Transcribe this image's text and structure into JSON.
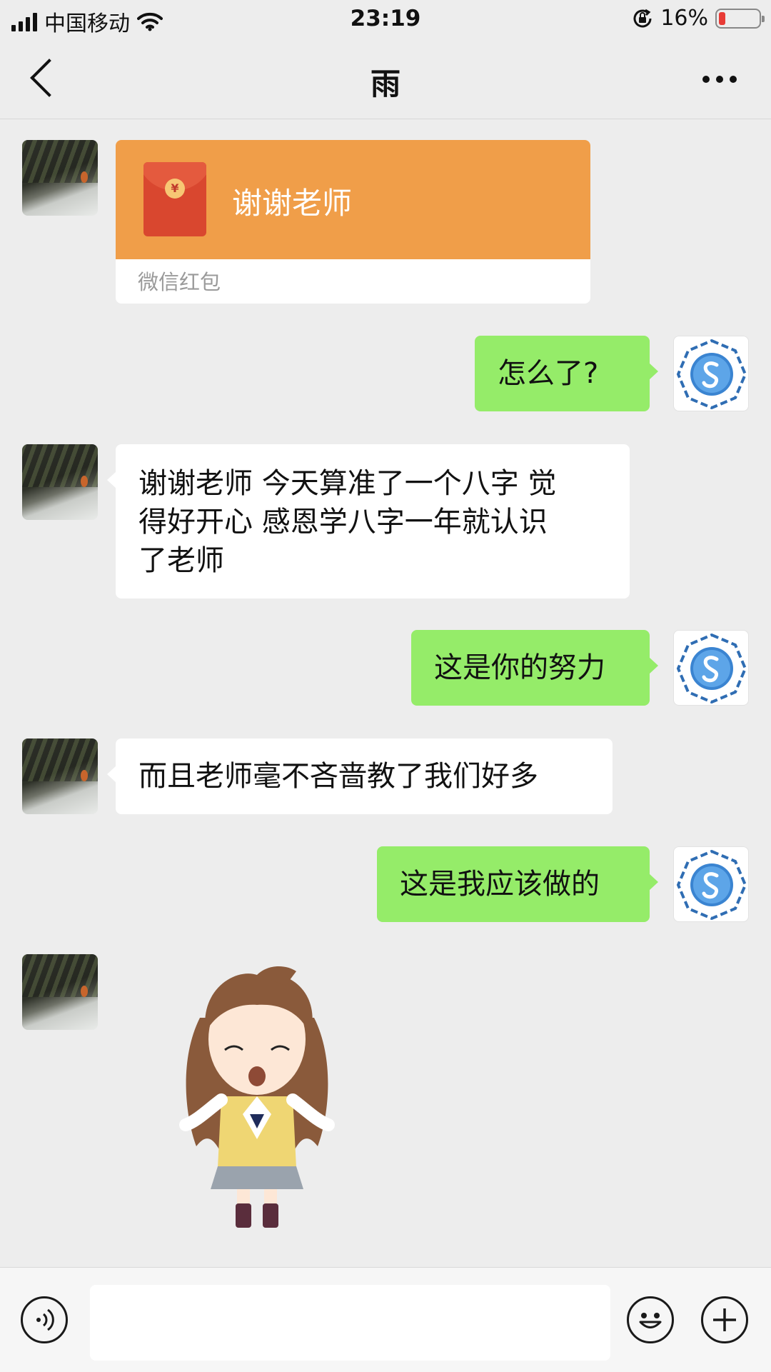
{
  "status_bar": {
    "carrier": "中国移动",
    "time": "23:19",
    "battery_percent_text": "16%",
    "battery_level": 0.16,
    "icons": [
      "signal-icon",
      "wifi-icon",
      "orientation-lock-icon",
      "battery-icon"
    ]
  },
  "header": {
    "title": "雨",
    "back_icon": "chevron-left-icon",
    "more_icon": "more-dots-icon"
  },
  "messages": [
    {
      "sender": "other",
      "type": "red_packet",
      "text": "谢谢老师",
      "label": "微信红包"
    },
    {
      "sender": "self",
      "type": "text",
      "text": "怎么了?"
    },
    {
      "sender": "other",
      "type": "text",
      "lines": [
        "谢谢老师 今天算准了一个八字 觉",
        "得好开心 感恩学八字一年就认识",
        "了老师"
      ]
    },
    {
      "sender": "self",
      "type": "text",
      "text": "这是你的努力"
    },
    {
      "sender": "other",
      "type": "text",
      "text": "而且老师毫不吝啬教了我们好多"
    },
    {
      "sender": "self",
      "type": "text",
      "text": "这是我应该做的"
    },
    {
      "sender": "other",
      "type": "sticker",
      "sticker": "girl-sticker"
    }
  ],
  "input_bar": {
    "voice_icon": "voice-icon",
    "emoji_icon": "emoji-icon",
    "plus_icon": "plus-icon",
    "text_value": ""
  },
  "colors": {
    "background": "#ededed",
    "self_bubble": "#95ec69",
    "other_bubble": "#ffffff",
    "red_packet": "#f09e49"
  }
}
